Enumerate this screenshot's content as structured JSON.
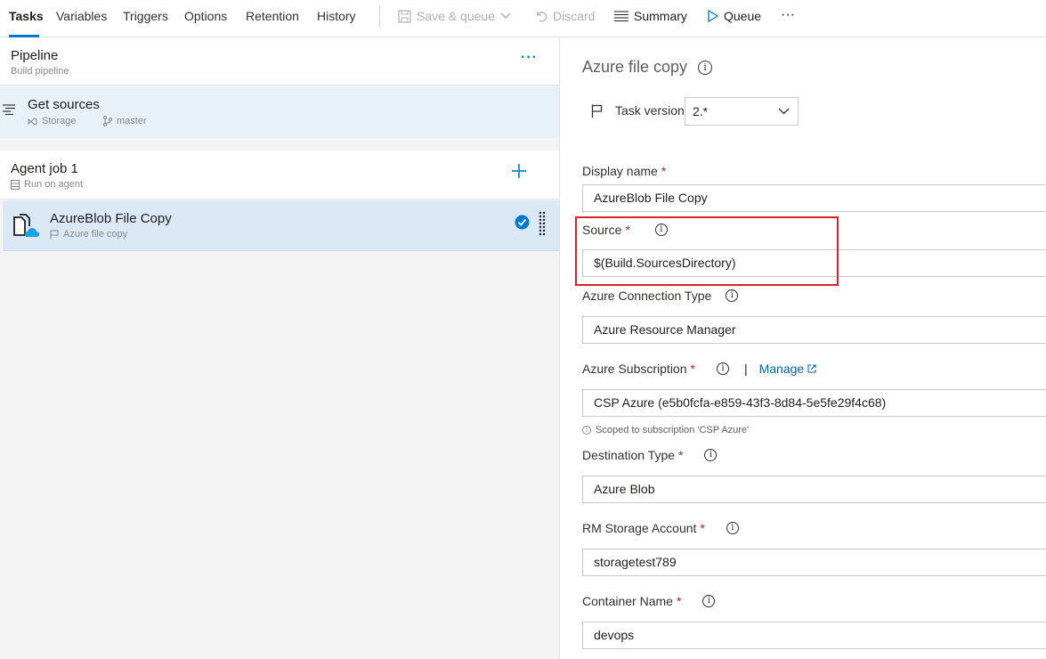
{
  "toolbar": {
    "tabs": [
      "Tasks",
      "Variables",
      "Triggers",
      "Options",
      "Retention",
      "History"
    ],
    "save_queue": "Save & queue",
    "discard": "Discard",
    "summary": "Summary",
    "queue": "Queue",
    "more": "···"
  },
  "pipeline": {
    "title": "Pipeline",
    "subtitle": "Build pipeline",
    "more": "···"
  },
  "sources": {
    "title": "Get sources",
    "repo": "Storage",
    "branch": "master"
  },
  "agent_job": {
    "title": "Agent job 1",
    "subtitle": "Run on agent"
  },
  "task": {
    "title": "AzureBlob File Copy",
    "subtitle": "Azure file copy"
  },
  "detail": {
    "title": "Azure file copy",
    "task_version_label": "Task version",
    "task_version_value": "2.*",
    "display_name": {
      "label": "Display name",
      "value": "AzureBlob File Copy"
    },
    "source": {
      "label": "Source",
      "value": "$(Build.SourcesDirectory)"
    },
    "connection_type": {
      "label": "Azure Connection Type",
      "value": "Azure Resource Manager"
    },
    "subscription": {
      "label": "Azure Subscription",
      "manage": "Manage",
      "value": "CSP Azure (e5b0fcfa-e859-43f3-8d84-5e5fe29f4c68)",
      "hint": "Scoped to subscription 'CSP Azure'"
    },
    "destination_type": {
      "label": "Destination Type",
      "value": "Azure Blob"
    },
    "storage_account": {
      "label": "RM Storage Account",
      "value": "storagetest789"
    },
    "container_name": {
      "label": "Container Name",
      "value": "devops"
    }
  },
  "colors": {
    "accent": "#0078d4",
    "highlight": "#d8232a",
    "selected": "#dbe8f5"
  }
}
